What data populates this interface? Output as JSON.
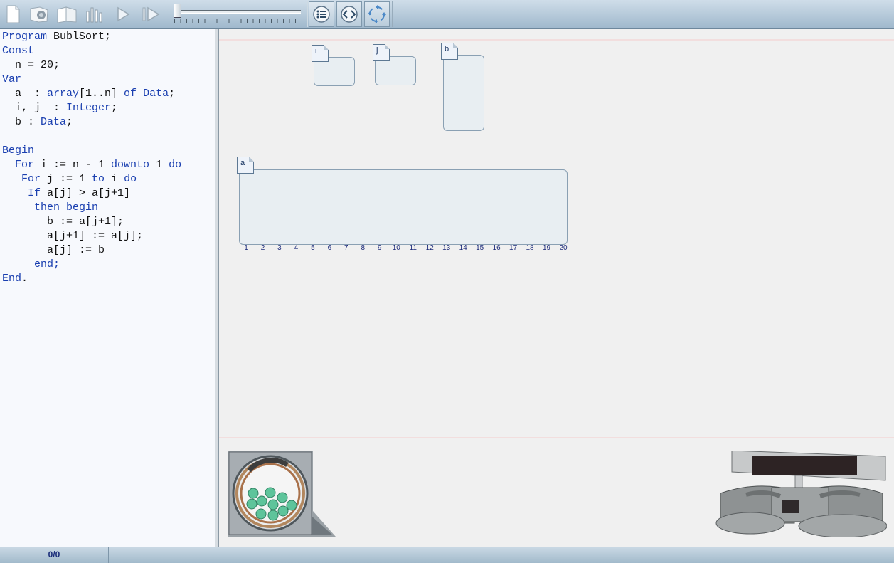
{
  "toolbar": {
    "buttons": [
      {
        "name": "new-document-icon"
      },
      {
        "name": "open-file-icon"
      },
      {
        "name": "book-icon"
      },
      {
        "name": "bar-chart-icon"
      },
      {
        "name": "play-icon"
      },
      {
        "name": "step-forward-icon"
      },
      {
        "name": "list-view-icon"
      },
      {
        "name": "code-view-icon"
      },
      {
        "name": "refresh-icon"
      }
    ],
    "speed_slider": {
      "value_fraction": 0.02
    }
  },
  "code": {
    "lines": [
      [
        "Program",
        " BublSort;"
      ],
      [
        "Const",
        ""
      ],
      [
        "",
        "  n = 20;"
      ],
      [
        "Var",
        ""
      ],
      [
        "",
        "  a  : "
      ],
      [
        "",
        "  i, j  : "
      ],
      [
        "",
        "  b : "
      ],
      [
        "",
        ""
      ],
      [
        "Begin",
        ""
      ],
      [
        "  For",
        " i := n - 1 "
      ],
      [
        "   For",
        " j := 1 "
      ],
      [
        "    If",
        " a[j] > a[j+1]"
      ],
      [
        "     then begin",
        ""
      ],
      [
        "",
        "       b := a[j+1];"
      ],
      [
        "",
        "       a[j+1] := a[j];"
      ],
      [
        "",
        "       a[j] := b"
      ],
      [
        "     end;",
        ""
      ],
      [
        "End",
        "."
      ]
    ],
    "line4_parts": [
      "array",
      "[1..n] ",
      "of",
      " ",
      "Data",
      ";"
    ],
    "line5_parts": [
      "Integer",
      ";"
    ],
    "line6_parts": [
      "Data",
      ";"
    ],
    "line9_parts": [
      "downto",
      " 1 ",
      "do"
    ],
    "line10_parts": [
      "to",
      " i ",
      "do"
    ]
  },
  "variables": {
    "i": {
      "label": "i"
    },
    "j": {
      "label": "j"
    },
    "b": {
      "label": "b"
    },
    "a": {
      "label": "a",
      "indices": [
        "1",
        "2",
        "3",
        "4",
        "5",
        "6",
        "7",
        "8",
        "9",
        "10",
        "11",
        "12",
        "13",
        "14",
        "15",
        "16",
        "17",
        "18",
        "19",
        "20"
      ]
    }
  },
  "status": {
    "counter": "0/0"
  },
  "colors": {
    "keyword": "#1a3fb0",
    "index": "#1b2a7a"
  }
}
